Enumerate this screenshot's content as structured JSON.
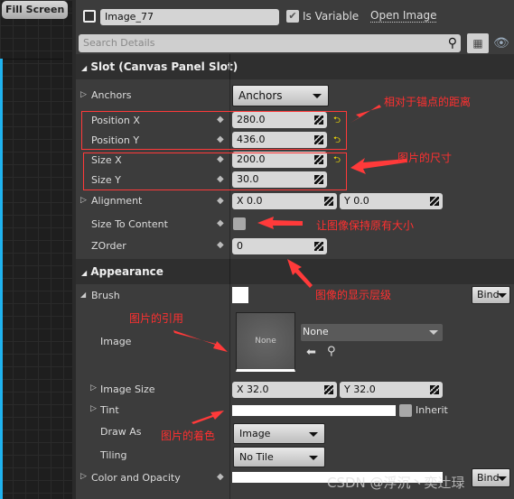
{
  "viewport": {
    "fill_screen_label": "Fill Screen"
  },
  "header": {
    "widget_name": "Image_77",
    "is_variable_label": "Is Variable",
    "is_variable_checked": true,
    "open_image_label": "Open Image"
  },
  "search": {
    "placeholder": "Search Details"
  },
  "slot": {
    "title": "Slot (Canvas Panel Slot)",
    "anchors_label": "Anchors",
    "anchors_value": "Anchors",
    "position_x_label": "Position X",
    "position_x": "280.0",
    "position_y_label": "Position Y",
    "position_y": "436.0",
    "size_x_label": "Size X",
    "size_x": "200.0",
    "size_y_label": "Size Y",
    "size_y": "30.0",
    "alignment_label": "Alignment",
    "alignment_x": "X  0.0",
    "alignment_y": "Y  0.0",
    "size_to_content_label": "Size To Content",
    "size_to_content_checked": false,
    "zorder_label": "ZOrder",
    "zorder": "0"
  },
  "appearance": {
    "title": "Appearance",
    "brush_label": "Brush",
    "bind_label": "Bind",
    "image_label": "Image",
    "image_thumb": "None",
    "image_asset": "None",
    "image_size_label": "Image Size",
    "image_size_x": "X  32.0",
    "image_size_y": "Y  32.0",
    "tint_label": "Tint",
    "inherit_label": "Inherit",
    "draw_as_label": "Draw As",
    "draw_as": "Image",
    "tiling_label": "Tiling",
    "tiling": "No Tile",
    "color_opacity_label": "Color and Opacity",
    "bind2_label": "Bind"
  },
  "annotations": {
    "position": "相对于锚点的距离",
    "size": "图片的尺寸",
    "size_to_content": "让图像保持原有大小",
    "zorder": "图像的显示层级",
    "image_ref": "图片的引用",
    "tint": "图片的着色"
  },
  "watermark": "CSDN @浮沉丶奕辻琭",
  "colors": {
    "annotation": "#ff3030",
    "selection": "#1fb3f0"
  }
}
